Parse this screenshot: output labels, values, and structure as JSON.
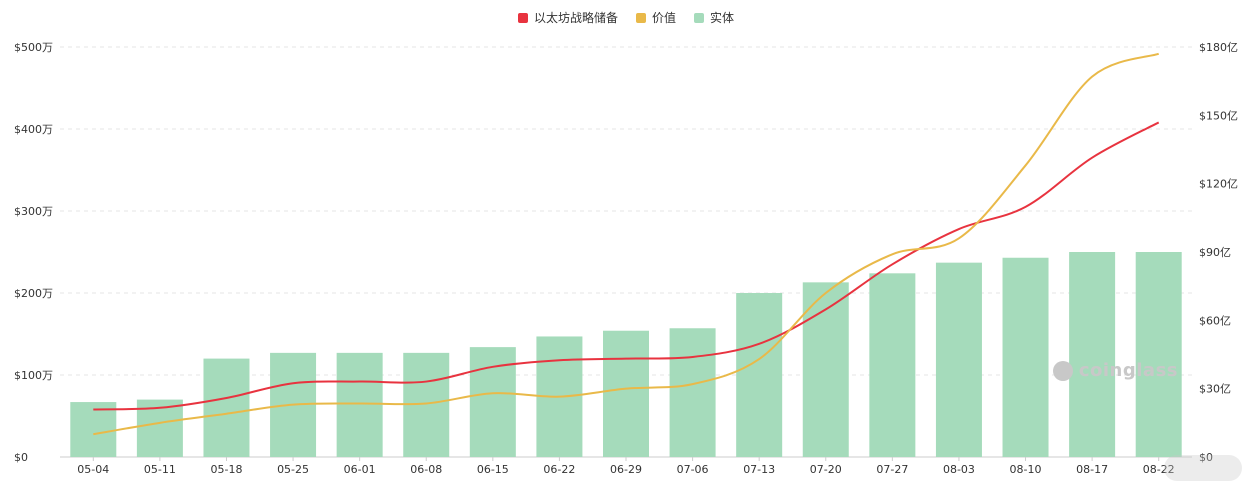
{
  "legend": {
    "items": [
      {
        "label": "以太坊战略储备",
        "color": "#e8333f"
      },
      {
        "label": "价值",
        "color": "#e9b949"
      },
      {
        "label": "实体",
        "color": "#a5dbbb"
      }
    ]
  },
  "watermark": {
    "text": "coinglass"
  },
  "chart_data": {
    "type": "bar",
    "categories": [
      "05-04",
      "05-11",
      "05-18",
      "05-25",
      "06-01",
      "06-08",
      "06-15",
      "06-22",
      "06-29",
      "07-06",
      "07-13",
      "07-20",
      "07-27",
      "08-03",
      "08-10",
      "08-17",
      "08-22"
    ],
    "left_axis": {
      "ticks": [
        "$0",
        "$100万",
        "$200万",
        "$300万",
        "$400万",
        "$500万"
      ],
      "range": [
        0,
        5000000
      ]
    },
    "right_axis": {
      "ticks": [
        "$0",
        "$30亿",
        "$60亿",
        "$90亿",
        "$120亿",
        "$150亿",
        "$180亿"
      ],
      "range": [
        0,
        18000000000
      ]
    },
    "grid": true,
    "legend_position": "top-center",
    "series": [
      {
        "name": "实体",
        "type": "bar",
        "axis": "left",
        "color": "#a5dbbb",
        "values": [
          670000,
          700000,
          1200000,
          1270000,
          1270000,
          1270000,
          1340000,
          1470000,
          1540000,
          1570000,
          2000000,
          2130000,
          2240000,
          2370000,
          2430000,
          2500000,
          2500000
        ]
      },
      {
        "name": "以太坊战略储备",
        "type": "line",
        "axis": "left",
        "color": "#e8333f",
        "values": [
          580000,
          600000,
          720000,
          900000,
          920000,
          920000,
          1100000,
          1180000,
          1200000,
          1220000,
          1380000,
          1800000,
          2350000,
          2780000,
          3050000,
          3650000,
          4080000
        ]
      },
      {
        "name": "价值",
        "type": "line",
        "axis": "right",
        "color": "#e9b949",
        "values": [
          1000000000,
          1500000000,
          1900000000,
          2300000000,
          2350000000,
          2350000000,
          2800000000,
          2650000000,
          3000000000,
          3200000000,
          4300000000,
          7200000000,
          8900000000,
          9600000000,
          12800000000,
          16700000000,
          17700000000
        ]
      }
    ]
  }
}
